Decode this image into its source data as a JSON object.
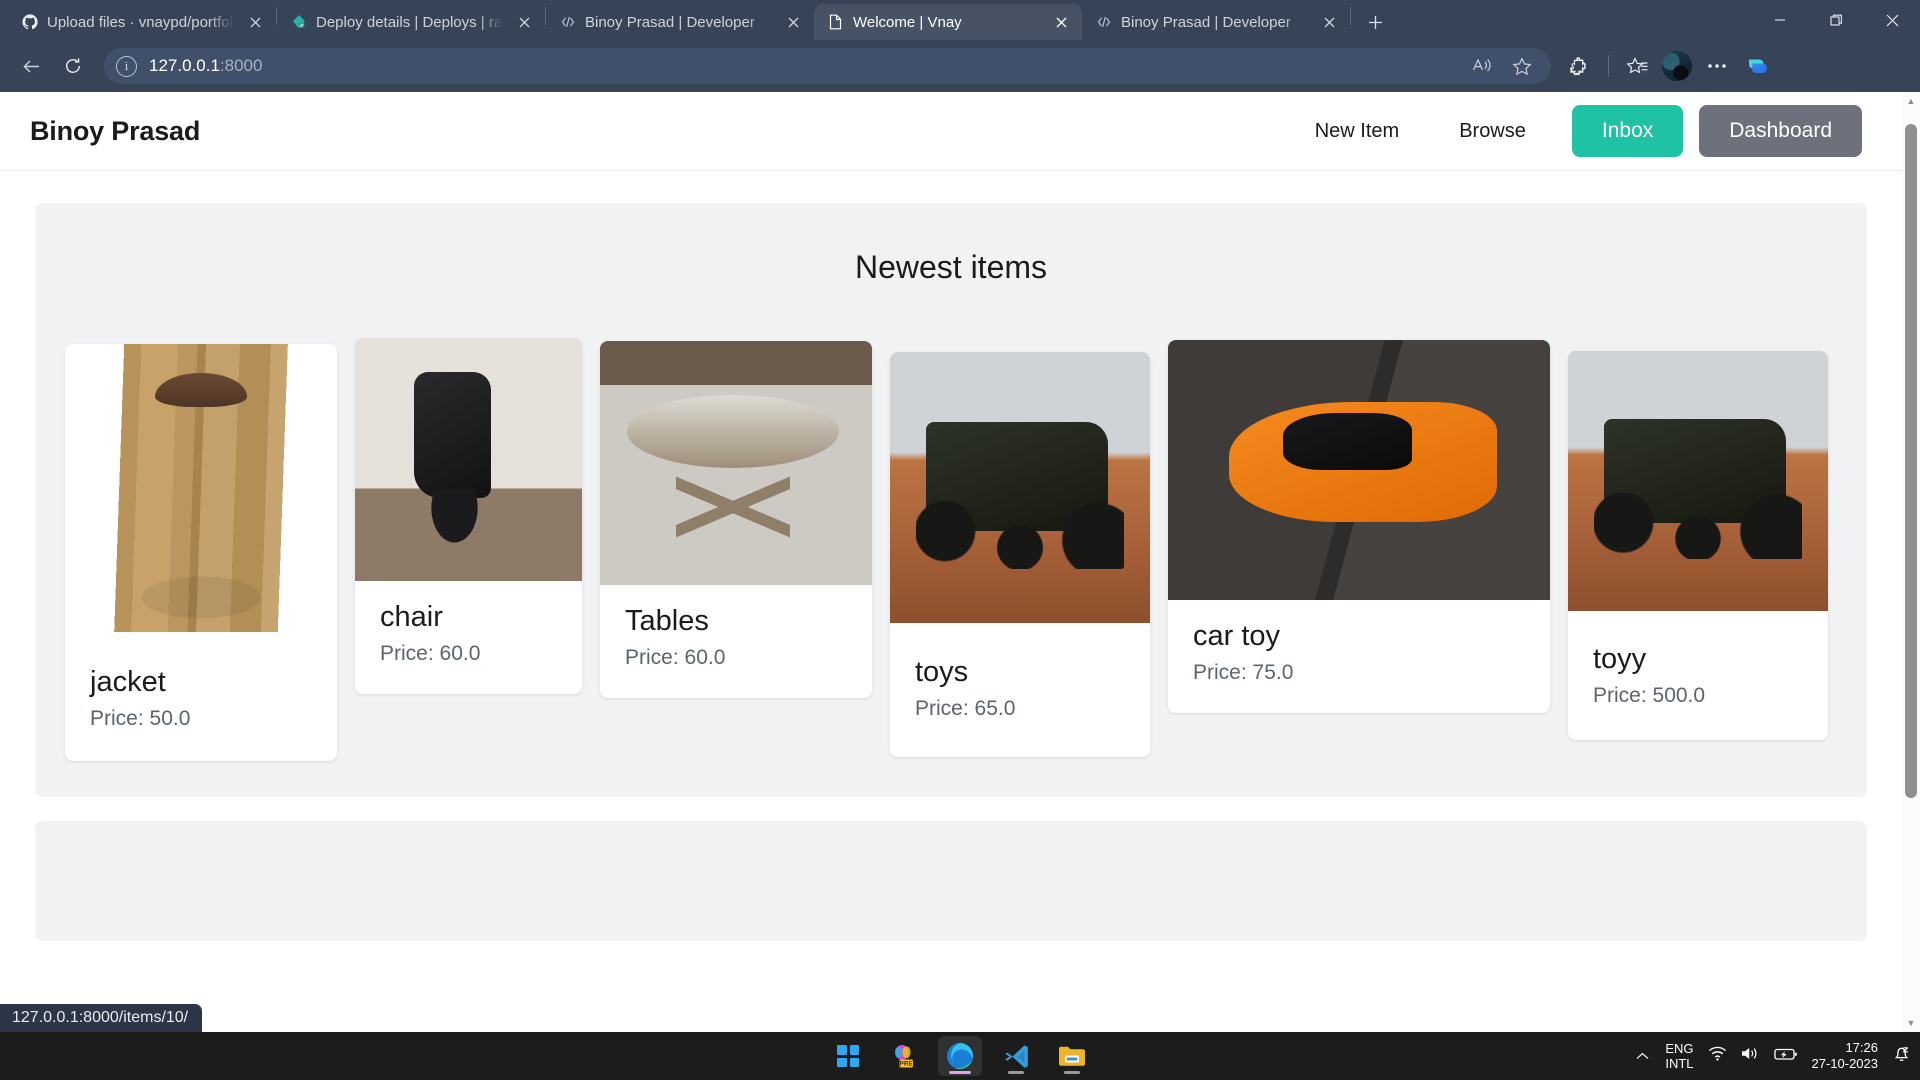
{
  "browser": {
    "tabs": [
      {
        "title": "Upload files · vnaypd/portfolio",
        "favicon": "github-icon",
        "active": false
      },
      {
        "title": "Deploy details | Deploys | rad-cri",
        "favicon": "netlify-icon",
        "active": false
      },
      {
        "title": "Binoy Prasad | Developer",
        "favicon": "code-icon",
        "active": false
      },
      {
        "title": "Welcome | Vnay",
        "favicon": "document-icon",
        "active": true
      },
      {
        "title": "Binoy Prasad | Developer",
        "favicon": "code-icon",
        "active": false
      }
    ],
    "new_tab_label": "+",
    "window_controls": {
      "minimize": "—",
      "maximize": "❐",
      "close": "✕"
    },
    "toolbar": {
      "back_icon": "back-arrow-icon",
      "reload_icon": "reload-icon",
      "site_info_icon": "info-icon",
      "url_host": "127.0.0.1",
      "url_port": ":8000",
      "read_aloud_icon": "read-aloud-icon",
      "favorite_icon": "star-icon",
      "extensions_icon": "extensions-icon",
      "collections_icon": "collections-icon",
      "profile_icon": "avatar-icon",
      "settings_icon": "more-options-icon",
      "copilot_icon": "copilot-icon"
    },
    "status_bubble": "127.0.0.1:8000/items/10/"
  },
  "page": {
    "navbar": {
      "brand": "Binoy Prasad",
      "links": [
        "New Item",
        "Browse"
      ],
      "inbox_label": "Inbox",
      "dashboard_label": "Dashboard",
      "inbox_color": "#20c2a4",
      "dashboard_color": "#6d717c"
    },
    "section": {
      "title": "Newest items",
      "price_prefix": "Price: ",
      "items": [
        {
          "name": "jacket",
          "price": "50.0",
          "price_label": "Price: 50.0",
          "image": "jacket-photo"
        },
        {
          "name": "chair",
          "price": "60.0",
          "price_label": "Price: 60.0",
          "image": "office-chair-photo"
        },
        {
          "name": "Tables",
          "price": "60.0",
          "price_label": "Price: 60.0",
          "image": "round-table-photo"
        },
        {
          "name": "toys",
          "price": "65.0",
          "price_label": "Price: 65.0",
          "image": "rc-buggy-photo"
        },
        {
          "name": "car toy",
          "price": "75.0",
          "price_label": "Price: 75.0",
          "image": "orange-sports-car-photo"
        },
        {
          "name": "toyy",
          "price": "500.0",
          "price_label": "Price: 500.0",
          "image": "rc-buggy-photo"
        }
      ]
    }
  },
  "taskbar": {
    "items": [
      {
        "name": "start-button",
        "icon": "windows-logo-icon",
        "active": false
      },
      {
        "name": "office-app",
        "icon": "office-preview-icon",
        "active": false,
        "badge": "PRE"
      },
      {
        "name": "edge-browser",
        "icon": "edge-icon",
        "active": true
      },
      {
        "name": "vs-code",
        "icon": "vscode-icon",
        "active": false
      },
      {
        "name": "file-explorer",
        "icon": "folder-icon",
        "active": false
      }
    ],
    "tray": {
      "show_hidden_icon": "chevron-up-icon",
      "language_primary": "ENG",
      "language_secondary": "INTL",
      "wifi_icon": "wifi-icon",
      "volume_icon": "speaker-icon",
      "battery_icon": "battery-charging-icon",
      "time": "17:26",
      "date": "27-10-2023",
      "notifications_icon": "notification-bell-silent-icon"
    }
  }
}
